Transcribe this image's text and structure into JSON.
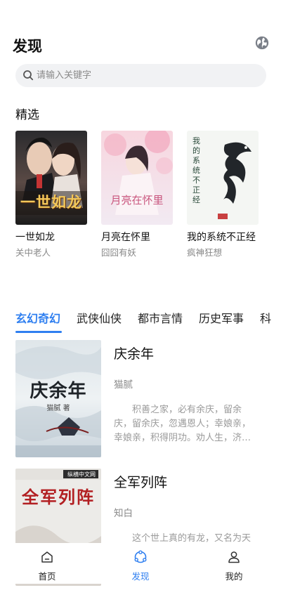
{
  "header": {
    "title": "发现",
    "globe_icon": "globe-icon"
  },
  "search": {
    "placeholder": "请输入关键字",
    "icon": "search-icon"
  },
  "featured": {
    "title": "精选",
    "books": [
      {
        "name": "一世如龙",
        "author": "关中老人",
        "cover_text": "一世如龙"
      },
      {
        "name": "月亮在怀里",
        "author": "囧囧有妖",
        "cover_text": "月亮在怀里"
      },
      {
        "name": "我的系统不正经",
        "author": "疯神狂想",
        "cover_text": "我的系统不正经"
      }
    ]
  },
  "tabs": [
    "玄幻奇幻",
    "武侠仙侠",
    "都市言情",
    "历史军事",
    "科"
  ],
  "active_tab": 0,
  "books": [
    {
      "title": "庆余年",
      "author": "猫腻",
      "description": "积善之家，必有余庆，留余庆，留余庆，忽遇恩人；幸娘亲，幸娘亲，积得阴功。劝人生，济困扶...",
      "cover_text": "庆余年",
      "cover_sub": "猫腻 著"
    },
    {
      "title": "全军列阵",
      "author": "知白",
      "description": "这个世上真的有龙，又名为天",
      "cover_text": "全军列阵",
      "cover_badge": "纵横中文网"
    }
  ],
  "bottom_nav": [
    {
      "label": "首页",
      "icon": "home-icon"
    },
    {
      "label": "发现",
      "icon": "discover-icon"
    },
    {
      "label": "我的",
      "icon": "profile-icon"
    }
  ],
  "colors": {
    "accent": "#2f7ff0",
    "muted": "#888888",
    "search_bg": "#f1f2f4"
  }
}
